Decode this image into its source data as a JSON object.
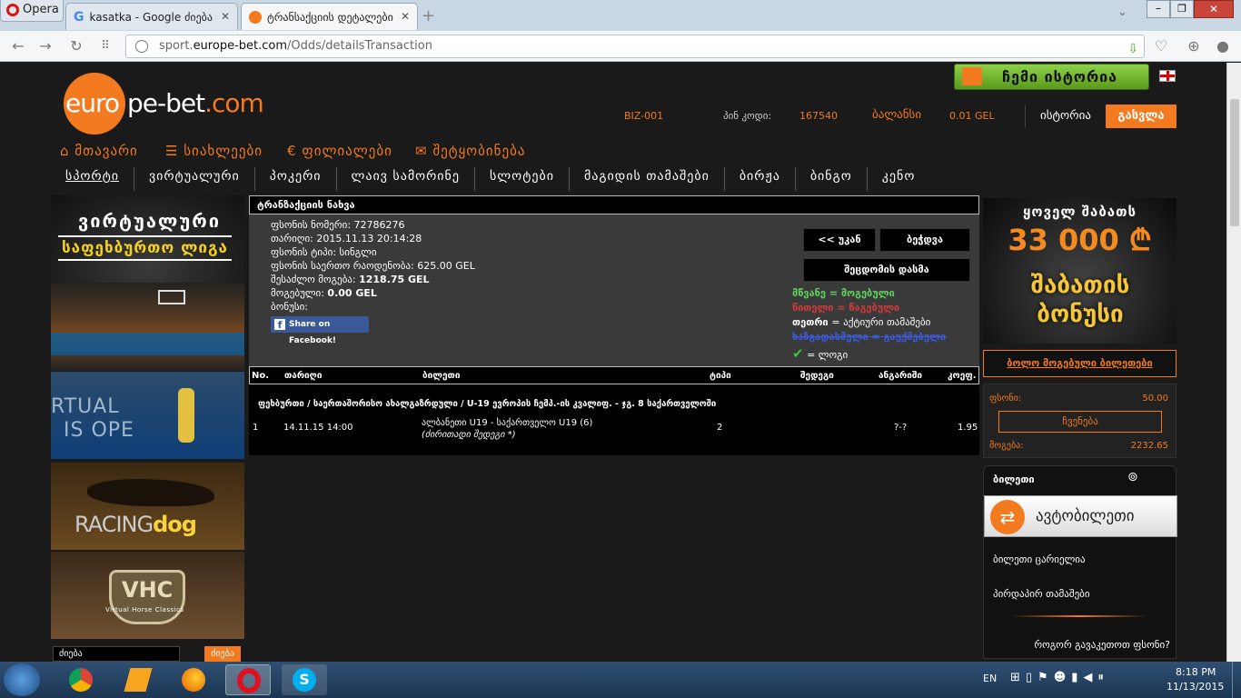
{
  "browser": {
    "opera_label": "Opera",
    "tabs": [
      {
        "label": "kasatka - Google ძიება"
      },
      {
        "label": "ტრანსაქციის დეტალები"
      }
    ],
    "url_prefix": "sport.",
    "url_domain": "europe-bet.com",
    "url_path": "/Odds/detailsTransaction"
  },
  "header": {
    "logo_euro": "euro",
    "logo_rest": "pe-bet",
    "logo_tld": ".com",
    "history_button": "ჩემი ისტორია",
    "user_id": "BIZ-001",
    "pin_label": "პინ კოდი:",
    "pin_value": "167540",
    "balance_label": "ბალანსი",
    "balance_value": "0.01 GEL",
    "history_link": "ისტორია",
    "logout_button": "გასვლა"
  },
  "main_nav": [
    {
      "label": "მთავარი",
      "icon": "home-icon"
    },
    {
      "label": "სიახლეები",
      "icon": "list-icon"
    },
    {
      "label": "ფილიალები",
      "icon": "euro-icon"
    },
    {
      "label": "შეტყობინება",
      "icon": "mail-icon"
    }
  ],
  "sub_nav": [
    "სპორტი",
    "ვირტუალური",
    "პოკერი",
    "ლაივ სამორინე",
    "სლოტები",
    "მაგიდის თამაშები",
    "ბირჟა",
    "ბინგო",
    "კენო"
  ],
  "left_banners": {
    "virtual_title_1": "ვირტუალური",
    "virtual_title_2": "საფეხბურთო ლიგა",
    "tennis_text_1": "RTUAL",
    "tennis_text_2": "IS OPE",
    "racing_text_1": "RACING",
    "racing_text_2": "dog",
    "vhc_text": "VHC",
    "vhc_sub": "Virtual Horse Classics",
    "search_placeholder": "ძიება",
    "search_button": "ძიება"
  },
  "transaction": {
    "title": "ტრანზაქციის ნახვა",
    "lines": [
      "ფსონის ნომერი: 72786276",
      "თარიღი: 2015.11.13 20:14:28",
      "ფსონის ტიპი: სინგლი",
      "ფსონის საერთო რაოდენობა: 625.00 GEL"
    ],
    "possible_win_label": "შესაძლო მოგება:",
    "possible_win_value": "1218.75 GEL",
    "win_label": "მოგებული:",
    "win_value": "0.00 GEL",
    "bonus_label": "ბონუსი:",
    "share_button": "Share on Facebook!",
    "back_button": "<< უკან",
    "print_button": "ბეჭდვა",
    "report_button": "შეცდომის დასმა",
    "legend": [
      {
        "key": "მწვანე",
        "text": "= მოგებული",
        "color": "#5fd35f"
      },
      {
        "key": "წითელი",
        "text": "= წაგებული",
        "color": "#d23a3a"
      },
      {
        "key": "თეთრი",
        "text": "= აქტიური თამაშები",
        "color": "#ffffff"
      },
      {
        "key": "ხაზგადასმული",
        "text": "= გაუქმებული",
        "color": "#3b5bdb"
      }
    ],
    "legend_check": "= ლოგი",
    "table_headers": [
      "No.",
      "თარიღი",
      "ბილეთი",
      "ტიპი",
      "შედეგი",
      "ანგარიში",
      "კოეფ."
    ],
    "event_category": "ფეხბურთი / საერთაშორისო ახალგაზრდული / U-19 ევროპის ჩემპ.-ის კვალიფ. - ჯგ. 8 საქართველოში",
    "rows": [
      {
        "no": "1",
        "date": "14.11.15 14:00",
        "ticket": "ალბანეთი U19 - საქართველო U19 (6)",
        "ticket_note": "(ძირითადი შედეგი *)",
        "type": "2",
        "result": "",
        "score": "?-?",
        "coef": "1.95"
      }
    ]
  },
  "right": {
    "promo_line1": "ყოველ შაბათს",
    "promo_amount": "33 000 ₾",
    "promo_big": "შაბათის ბონუსი",
    "last_winners": "ბოლო მოგებული ბილეთები",
    "bet_label": "ფსონი:",
    "bet_value": "50.00",
    "choose_button": "ჩვენება",
    "win_label": "მოგება:",
    "win_value": "2232.65",
    "ticket_header": "ბილეთი",
    "auto_ticket": "ავტობილეთი",
    "empty_ticket": "ბილეთი ცარიელია",
    "live_games": "პირდაპირ თამაშები",
    "how_to_bet": "როგორ გავაკეთოთ ფსონი?"
  },
  "taskbar": {
    "lang": "EN",
    "time": "8:18 PM",
    "date": "11/13/2015"
  },
  "colors": {
    "accent": "#f47a1f",
    "green": "#5fd35f",
    "background": "#1a1a1a"
  }
}
